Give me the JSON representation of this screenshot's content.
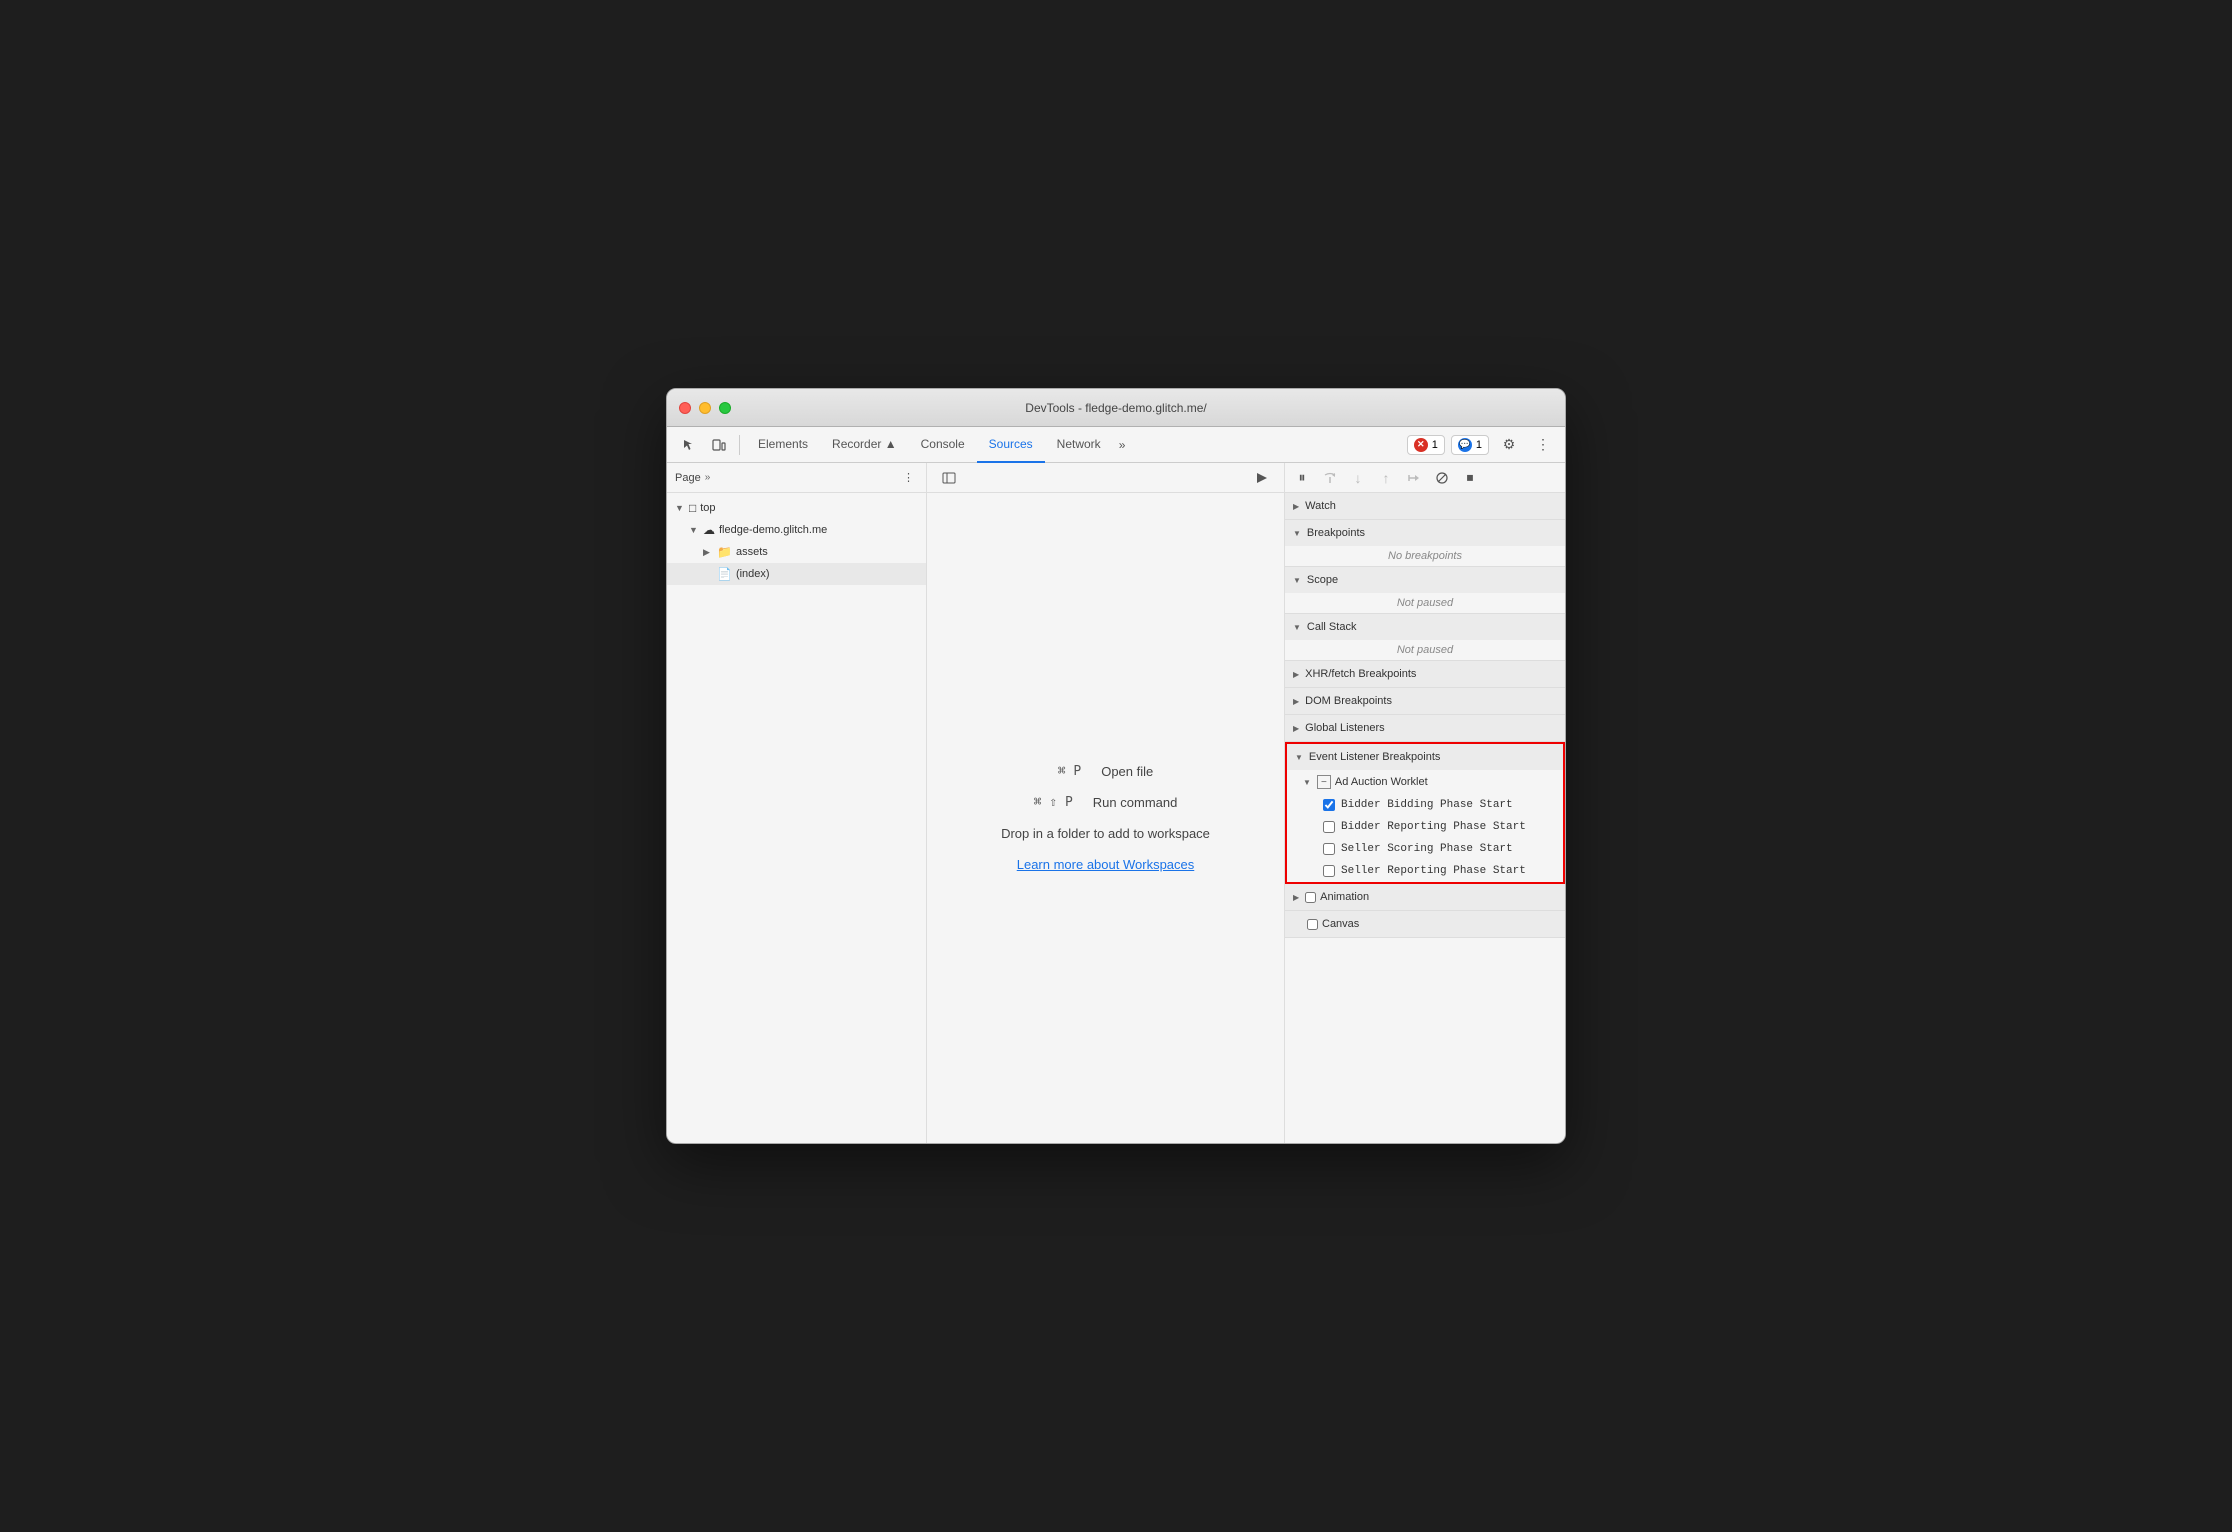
{
  "window": {
    "title": "DevTools - fledge-demo.glitch.me/"
  },
  "traffic_lights": {
    "close": "close",
    "minimize": "minimize",
    "maximize": "maximize"
  },
  "toolbar": {
    "tabs": [
      {
        "id": "elements",
        "label": "Elements",
        "active": false
      },
      {
        "id": "recorder",
        "label": "Recorder ▲",
        "active": false
      },
      {
        "id": "console",
        "label": "Console",
        "active": false
      },
      {
        "id": "sources",
        "label": "Sources",
        "active": true
      },
      {
        "id": "network",
        "label": "Network",
        "active": false
      }
    ],
    "more_tabs_label": "»",
    "error_badge": "1",
    "info_badge": "1",
    "settings_icon": "⚙",
    "more_icon": "⋮"
  },
  "left_panel": {
    "header_label": "Page",
    "header_more": "»",
    "tree": [
      {
        "id": "top",
        "label": "top",
        "indent": 0,
        "type": "folder",
        "expanded": true,
        "arrow": "▼"
      },
      {
        "id": "fledge-demo",
        "label": "fledge-demo.glitch.me",
        "indent": 1,
        "type": "cloud",
        "expanded": true,
        "arrow": "▼"
      },
      {
        "id": "assets",
        "label": "assets",
        "indent": 2,
        "type": "folder",
        "expanded": false,
        "arrow": "▶"
      },
      {
        "id": "index",
        "label": "(index)",
        "indent": 2,
        "type": "file",
        "expanded": false,
        "arrow": "",
        "selected": true
      }
    ]
  },
  "middle_panel": {
    "shortcut1": {
      "keys": "⌘ P",
      "label": "Open file"
    },
    "shortcut2": {
      "keys": "⌘ ⇧ P",
      "label": "Run command"
    },
    "drop_text": "Drop in a folder to add to workspace",
    "workspace_link": "Learn more about Workspaces"
  },
  "right_panel": {
    "debug_buttons": [
      {
        "id": "pause",
        "icon": "⏸",
        "disabled": false
      },
      {
        "id": "step-over",
        "icon": "↷",
        "disabled": true
      },
      {
        "id": "step-into",
        "icon": "↓",
        "disabled": true
      },
      {
        "id": "step-out",
        "icon": "↑",
        "disabled": true
      },
      {
        "id": "step",
        "icon": "⇒",
        "disabled": true
      },
      {
        "id": "deactivate",
        "icon": "⊘",
        "disabled": false
      },
      {
        "id": "stop-on-exception",
        "icon": "⏹",
        "disabled": false
      }
    ],
    "sections": [
      {
        "id": "watch",
        "label": "Watch",
        "expanded": false,
        "arrow": "▶",
        "content": null
      },
      {
        "id": "breakpoints",
        "label": "Breakpoints",
        "expanded": true,
        "arrow": "▼",
        "content": "No breakpoints"
      },
      {
        "id": "scope",
        "label": "Scope",
        "expanded": true,
        "arrow": "▼",
        "content": "Not paused"
      },
      {
        "id": "call-stack",
        "label": "Call Stack",
        "expanded": true,
        "arrow": "▼",
        "content": "Not paused"
      },
      {
        "id": "xhr-breakpoints",
        "label": "XHR/fetch Breakpoints",
        "expanded": false,
        "arrow": "▶",
        "content": null
      },
      {
        "id": "dom-breakpoints",
        "label": "DOM Breakpoints",
        "expanded": false,
        "arrow": "▶",
        "content": null
      },
      {
        "id": "global-listeners",
        "label": "Global Listeners",
        "expanded": false,
        "arrow": "▶",
        "content": null
      }
    ],
    "event_listener_breakpoints": {
      "label": "Event Listener Breakpoints",
      "arrow": "▼",
      "highlighted": true,
      "subsections": [
        {
          "id": "ad-auction-worklet",
          "label": "Ad Auction Worklet",
          "arrow": "▼",
          "expanded": true,
          "checkboxes": [
            {
              "id": "bidder-bidding",
              "label": "Bidder Bidding Phase Start",
              "checked": true
            },
            {
              "id": "bidder-reporting",
              "label": "Bidder Reporting Phase Start",
              "checked": false
            },
            {
              "id": "seller-scoring",
              "label": "Seller Scoring Phase Start",
              "checked": false
            },
            {
              "id": "seller-reporting",
              "label": "Seller Reporting Phase Start",
              "checked": false
            }
          ]
        }
      ]
    },
    "animation_section": {
      "label": "Animation",
      "arrow": "▶",
      "expanded": false
    },
    "canvas_section": {
      "label": "Canvas",
      "arrow": "▶",
      "expanded": false
    }
  }
}
